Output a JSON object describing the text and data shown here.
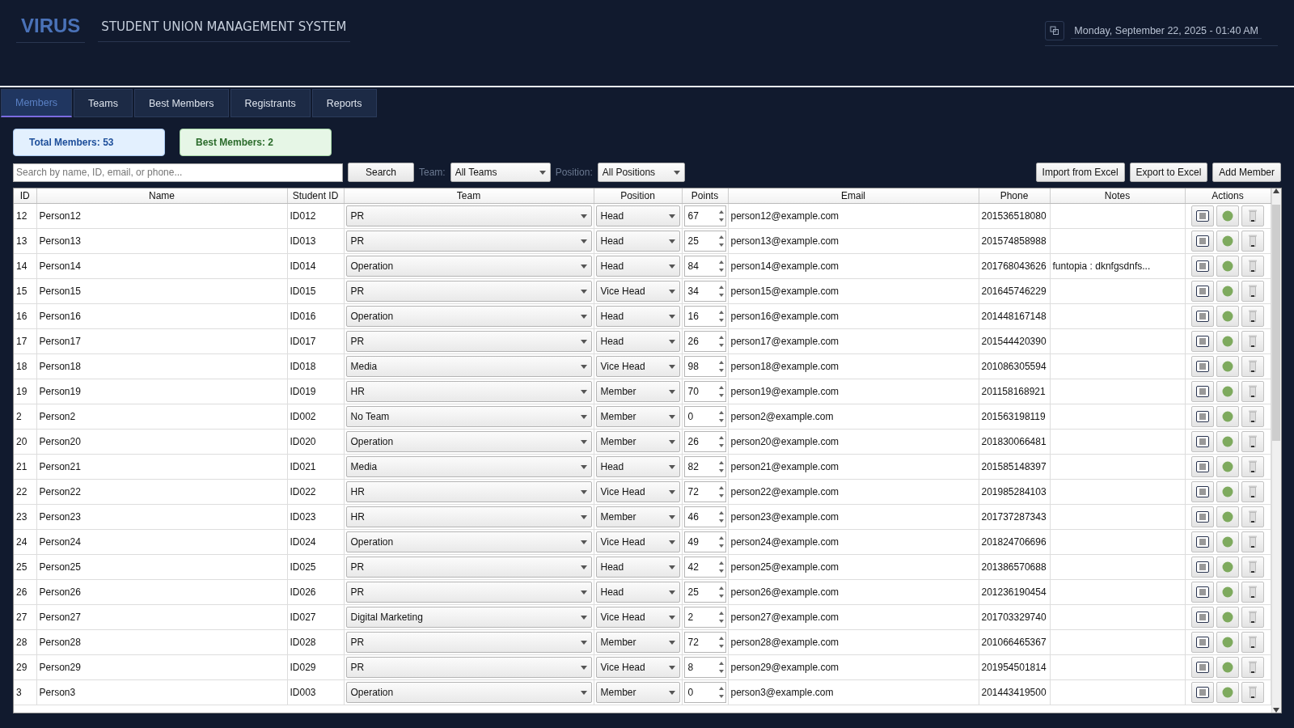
{
  "header": {
    "logo": "VIRUS",
    "title": "STUDENT UNION MANAGEMENT SYSTEM",
    "datetime": "Monday, September 22, 2025 - 01:40 AM"
  },
  "tabs": [
    {
      "label": "Members",
      "selected": true
    },
    {
      "label": "Teams",
      "selected": false
    },
    {
      "label": "Best Members",
      "selected": false
    },
    {
      "label": "Registrants",
      "selected": false
    },
    {
      "label": "Reports",
      "selected": false
    }
  ],
  "stats": [
    {
      "kind": "total",
      "label": "Total Members: 53"
    },
    {
      "kind": "best",
      "label": "Best Members: 2"
    }
  ],
  "toolbar": {
    "search_placeholder": "Search by name, ID, email, or phone...",
    "search_button": "Search",
    "team_label": "Team:",
    "team_value": "All Teams",
    "position_label": "Position:",
    "position_value": "All Positions",
    "buttons": [
      "Import from Excel",
      "Export to Excel",
      "Add Member"
    ]
  },
  "table": {
    "columns": [
      "ID",
      "Name",
      "Student ID",
      "Team",
      "Position",
      "Points",
      "Email",
      "Phone",
      "Notes",
      "Actions"
    ],
    "rows": [
      {
        "id": "12",
        "name": "Person12",
        "student_id": "ID012",
        "team": "PR",
        "position": "Head",
        "points": "67",
        "email": "person12@example.com",
        "phone": "201536518080"
      },
      {
        "id": "13",
        "name": "Person13",
        "student_id": "ID013",
        "team": "PR",
        "position": "Head",
        "points": "25",
        "email": "person13@example.com",
        "phone": "201574858988"
      },
      {
        "id": "14",
        "name": "Person14",
        "student_id": "ID014",
        "team": "Operation",
        "position": "Head",
        "points": "84",
        "email": "person14@example.com",
        "phone": "201768043626",
        "notes": "funtopia : dknfgsdnfs..."
      },
      {
        "id": "15",
        "name": "Person15",
        "student_id": "ID015",
        "team": "PR",
        "position": "Vice Head",
        "points": "34",
        "email": "person15@example.com",
        "phone": "201645746229"
      },
      {
        "id": "16",
        "name": "Person16",
        "student_id": "ID016",
        "team": "Operation",
        "position": "Head",
        "points": "16",
        "email": "person16@example.com",
        "phone": "201448167148"
      },
      {
        "id": "17",
        "name": "Person17",
        "student_id": "ID017",
        "team": "PR",
        "position": "Head",
        "points": "26",
        "email": "person17@example.com",
        "phone": "201544420390"
      },
      {
        "id": "18",
        "name": "Person18",
        "student_id": "ID018",
        "team": "Media",
        "position": "Vice Head",
        "points": "98",
        "email": "person18@example.com",
        "phone": "201086305594"
      },
      {
        "id": "19",
        "name": "Person19",
        "student_id": "ID019",
        "team": "HR",
        "position": "Member",
        "points": "70",
        "email": "person19@example.com",
        "phone": "201158168921"
      },
      {
        "id": "2",
        "name": "Person2",
        "student_id": "ID002",
        "team": "No Team",
        "position": "Member",
        "points": "0",
        "email": "person2@example.com",
        "phone": "201563198119"
      },
      {
        "id": "20",
        "name": "Person20",
        "student_id": "ID020",
        "team": "Operation",
        "position": "Member",
        "points": "26",
        "email": "person20@example.com",
        "phone": "201830066481"
      },
      {
        "id": "21",
        "name": "Person21",
        "student_id": "ID021",
        "team": "Media",
        "position": "Head",
        "points": "82",
        "email": "person21@example.com",
        "phone": "201585148397"
      },
      {
        "id": "22",
        "name": "Person22",
        "student_id": "ID022",
        "team": "HR",
        "position": "Vice Head",
        "points": "72",
        "email": "person22@example.com",
        "phone": "201985284103"
      },
      {
        "id": "23",
        "name": "Person23",
        "student_id": "ID023",
        "team": "HR",
        "position": "Member",
        "points": "46",
        "email": "person23@example.com",
        "phone": "201737287343"
      },
      {
        "id": "24",
        "name": "Person24",
        "student_id": "ID024",
        "team": "Operation",
        "position": "Vice Head",
        "points": "49",
        "email": "person24@example.com",
        "phone": "201824706696"
      },
      {
        "id": "25",
        "name": "Person25",
        "student_id": "ID025",
        "team": "PR",
        "position": "Head",
        "points": "42",
        "email": "person25@example.com",
        "phone": "201386570688"
      },
      {
        "id": "26",
        "name": "Person26",
        "student_id": "ID026",
        "team": "PR",
        "position": "Head",
        "points": "25",
        "email": "person26@example.com",
        "phone": "201236190454"
      },
      {
        "id": "27",
        "name": "Person27",
        "student_id": "ID027",
        "team": "Digital Marketing",
        "position": "Vice Head",
        "points": "2",
        "email": "person27@example.com",
        "phone": "201703329740"
      },
      {
        "id": "28",
        "name": "Person28",
        "student_id": "ID028",
        "team": "PR",
        "position": "Member",
        "points": "72",
        "email": "person28@example.com",
        "phone": "201066465367"
      },
      {
        "id": "29",
        "name": "Person29",
        "student_id": "ID029",
        "team": "PR",
        "position": "Vice Head",
        "points": "8",
        "email": "person29@example.com",
        "phone": "201954501814"
      },
      {
        "id": "3",
        "name": "Person3",
        "student_id": "ID003",
        "team": "Operation",
        "position": "Member",
        "points": "0",
        "email": "person3@example.com",
        "phone": "201443419500"
      }
    ]
  }
}
